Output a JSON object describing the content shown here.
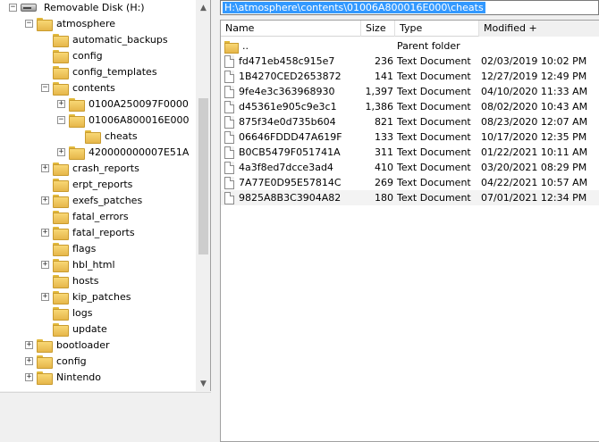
{
  "tree": {
    "items": [
      {
        "label": "Removable Disk (H:)",
        "expander": "−",
        "icon": "drive-icon",
        "level": 0
      },
      {
        "label": "atmosphere",
        "expander": "−",
        "icon": "folder-icon",
        "level": 1
      },
      {
        "label": "automatic_backups",
        "expander": "",
        "icon": "folder-icon",
        "level": 2
      },
      {
        "label": "config",
        "expander": "",
        "icon": "folder-icon",
        "level": 2
      },
      {
        "label": "config_templates",
        "expander": "",
        "icon": "folder-icon",
        "level": 2
      },
      {
        "label": "contents",
        "expander": "−",
        "icon": "folder-icon",
        "level": 2
      },
      {
        "label": "0100A250097F0000",
        "expander": "+",
        "icon": "folder-icon",
        "level": 3
      },
      {
        "label": "01006A800016E000",
        "expander": "−",
        "icon": "folder-icon",
        "level": 3
      },
      {
        "label": "cheats",
        "expander": "",
        "icon": "folder-icon",
        "level": 4
      },
      {
        "label": "420000000007E51A",
        "expander": "+",
        "icon": "folder-icon",
        "level": 3
      },
      {
        "label": "crash_reports",
        "expander": "+",
        "icon": "folder-icon",
        "level": 2
      },
      {
        "label": "erpt_reports",
        "expander": "",
        "icon": "folder-icon",
        "level": 2
      },
      {
        "label": "exefs_patches",
        "expander": "+",
        "icon": "folder-icon",
        "level": 2
      },
      {
        "label": "fatal_errors",
        "expander": "",
        "icon": "folder-icon",
        "level": 2
      },
      {
        "label": "fatal_reports",
        "expander": "+",
        "icon": "folder-icon",
        "level": 2
      },
      {
        "label": "flags",
        "expander": "",
        "icon": "folder-icon",
        "level": 2
      },
      {
        "label": "hbl_html",
        "expander": "+",
        "icon": "folder-icon",
        "level": 2
      },
      {
        "label": "hosts",
        "expander": "",
        "icon": "folder-icon",
        "level": 2
      },
      {
        "label": "kip_patches",
        "expander": "+",
        "icon": "folder-icon",
        "level": 2
      },
      {
        "label": "logs",
        "expander": "",
        "icon": "folder-icon",
        "level": 2
      },
      {
        "label": "update",
        "expander": "",
        "icon": "folder-icon",
        "level": 2
      },
      {
        "label": "bootloader",
        "expander": "+",
        "icon": "folder-icon",
        "level": 1
      },
      {
        "label": "config",
        "expander": "+",
        "icon": "folder-icon",
        "level": 1
      },
      {
        "label": "Nintendo",
        "expander": "+",
        "icon": "folder-icon",
        "level": 1
      }
    ],
    "selected_index": 8
  },
  "path_bar": {
    "value": "H:\\atmosphere\\contents\\01006A800016E000\\cheats"
  },
  "list": {
    "columns": {
      "name": "Name",
      "size": "Size",
      "type": "Type",
      "modified": "Modified"
    },
    "sort_indicator": "+",
    "rows": [
      {
        "name": "..",
        "size": "",
        "type": "Parent folder",
        "modified": "",
        "icon": "folder-icon"
      },
      {
        "name": "fd471eb458c915e7",
        "size": "236",
        "type": "Text Document",
        "modified": "02/03/2019 10:02 PM",
        "icon": "document-icon"
      },
      {
        "name": "1B4270CED2653872",
        "size": "141",
        "type": "Text Document",
        "modified": "12/27/2019 12:49 PM",
        "icon": "document-icon"
      },
      {
        "name": "9fe4e3c363968930",
        "size": "1,397",
        "type": "Text Document",
        "modified": "04/10/2020 11:33 AM",
        "icon": "document-icon"
      },
      {
        "name": "d45361e905c9e3c1",
        "size": "1,386",
        "type": "Text Document",
        "modified": "08/02/2020 10:43 AM",
        "icon": "document-icon"
      },
      {
        "name": "875f34e0d735b604",
        "size": "821",
        "type": "Text Document",
        "modified": "08/23/2020 12:07 AM",
        "icon": "document-icon"
      },
      {
        "name": "06646FDDD47A619F",
        "size": "133",
        "type": "Text Document",
        "modified": "10/17/2020 12:35 PM",
        "icon": "document-icon"
      },
      {
        "name": "B0CB5479F051741A",
        "size": "311",
        "type": "Text Document",
        "modified": "01/22/2021 10:11 AM",
        "icon": "document-icon"
      },
      {
        "name": "4a3f8ed7dcce3ad4",
        "size": "410",
        "type": "Text Document",
        "modified": "03/20/2021 08:29 PM",
        "icon": "document-icon"
      },
      {
        "name": "7A77E0D95E57814C",
        "size": "269",
        "type": "Text Document",
        "modified": "04/22/2021 10:57 AM",
        "icon": "document-icon"
      },
      {
        "name": "9825A8B3C3904A82",
        "size": "180",
        "type": "Text Document",
        "modified": "07/01/2021 12:34 PM",
        "icon": "document-icon"
      }
    ],
    "selected_row": 10
  },
  "colors": {
    "selection": "#3399ff",
    "folder": "#f8d775"
  }
}
